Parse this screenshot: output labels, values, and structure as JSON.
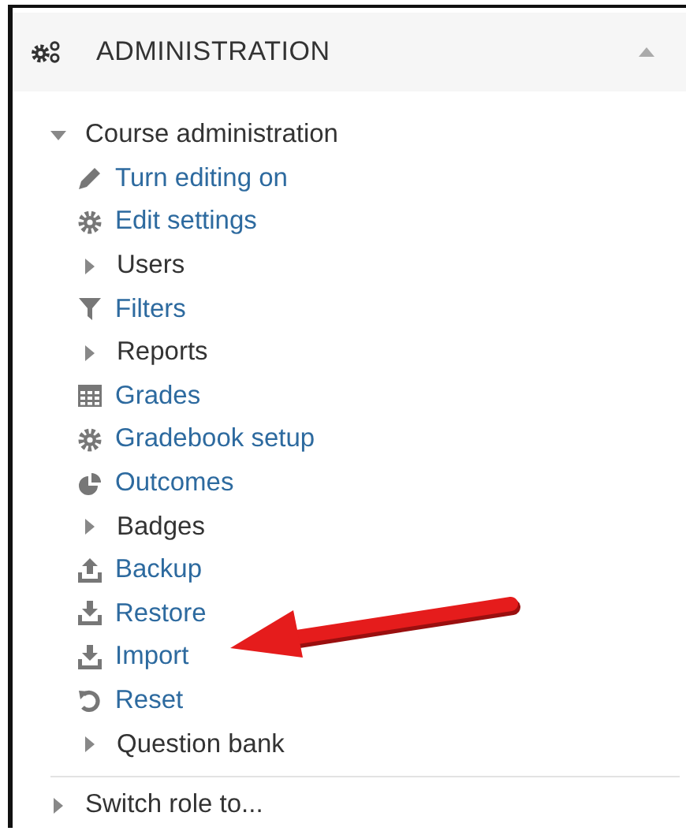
{
  "block": {
    "title": "ADMINISTRATION",
    "expanded": true
  },
  "tree": [
    {
      "label": "Course administration",
      "expanded": true,
      "children": [
        {
          "label": "Turn editing on",
          "kind": "link"
        },
        {
          "label": "Edit settings",
          "kind": "link"
        },
        {
          "label": "Users",
          "kind": "branch",
          "expanded": false
        },
        {
          "label": "Filters",
          "kind": "link"
        },
        {
          "label": "Reports",
          "kind": "branch",
          "expanded": false
        },
        {
          "label": "Grades",
          "kind": "link"
        },
        {
          "label": "Gradebook setup",
          "kind": "link"
        },
        {
          "label": "Outcomes",
          "kind": "link"
        },
        {
          "label": "Badges",
          "kind": "branch",
          "expanded": false
        },
        {
          "label": "Backup",
          "kind": "link"
        },
        {
          "label": "Restore",
          "kind": "link"
        },
        {
          "label": "Import",
          "kind": "link"
        },
        {
          "label": "Reset",
          "kind": "link"
        },
        {
          "label": "Question bank",
          "kind": "branch",
          "expanded": false
        }
      ]
    },
    {
      "label": "Switch role to...",
      "expanded": false
    }
  ]
}
